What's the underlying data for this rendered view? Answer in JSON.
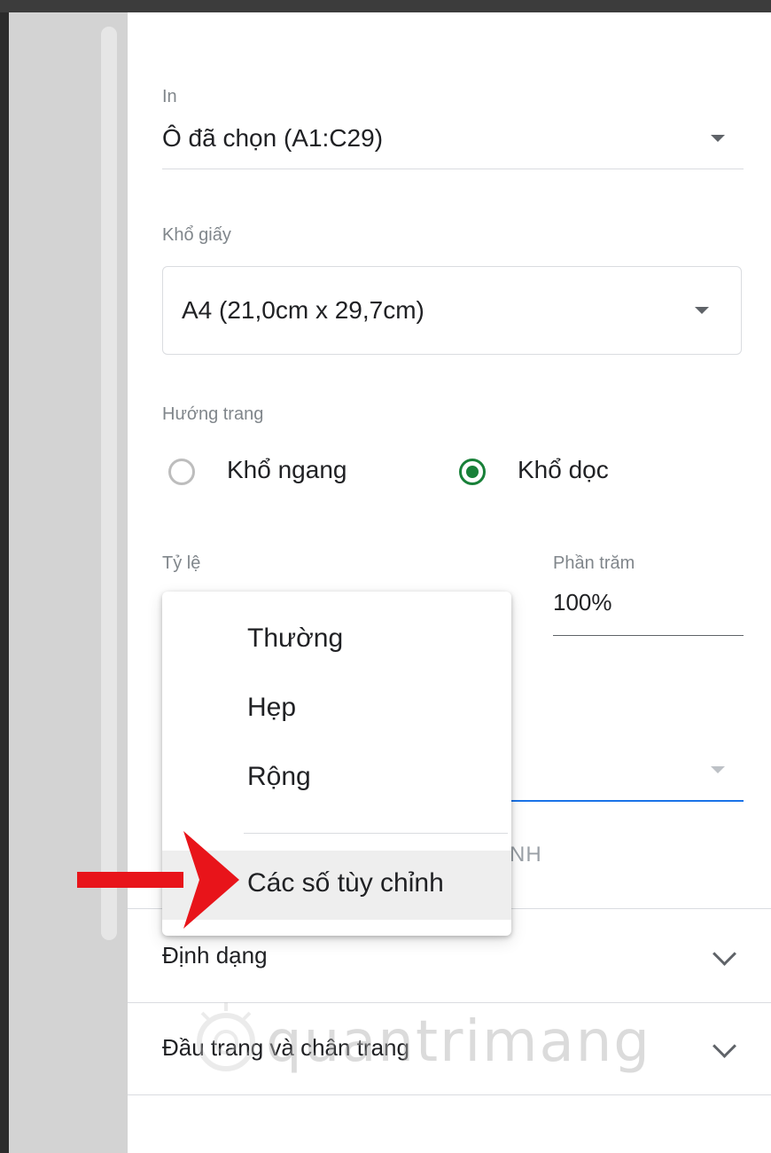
{
  "print_scope": {
    "label": "In",
    "value": "Ô đã chọn (A1:C29)"
  },
  "paper_size": {
    "label": "Khổ giấy",
    "value": "A4 (21,0cm x 29,7cm)"
  },
  "orientation": {
    "label": "Hướng trang",
    "options": [
      {
        "label": "Khổ ngang",
        "selected": false
      },
      {
        "label": "Khổ dọc",
        "selected": true
      }
    ]
  },
  "scale": {
    "label": "Tỷ lệ"
  },
  "percent": {
    "label": "Phần trăm",
    "value": "100%"
  },
  "margins_menu": {
    "items": [
      "Thường",
      "Hẹp",
      "Rộng"
    ],
    "custom_item": "Các số tùy chỉnh"
  },
  "partially_hidden_text": "NH",
  "sections": {
    "format": "Định dạng",
    "header_footer": "Đầu trang và chân trang"
  },
  "colors": {
    "accent_green": "#188038",
    "focus_blue": "#1a73e8",
    "annotation_red": "#e8141a"
  },
  "watermark": "quantrimang"
}
